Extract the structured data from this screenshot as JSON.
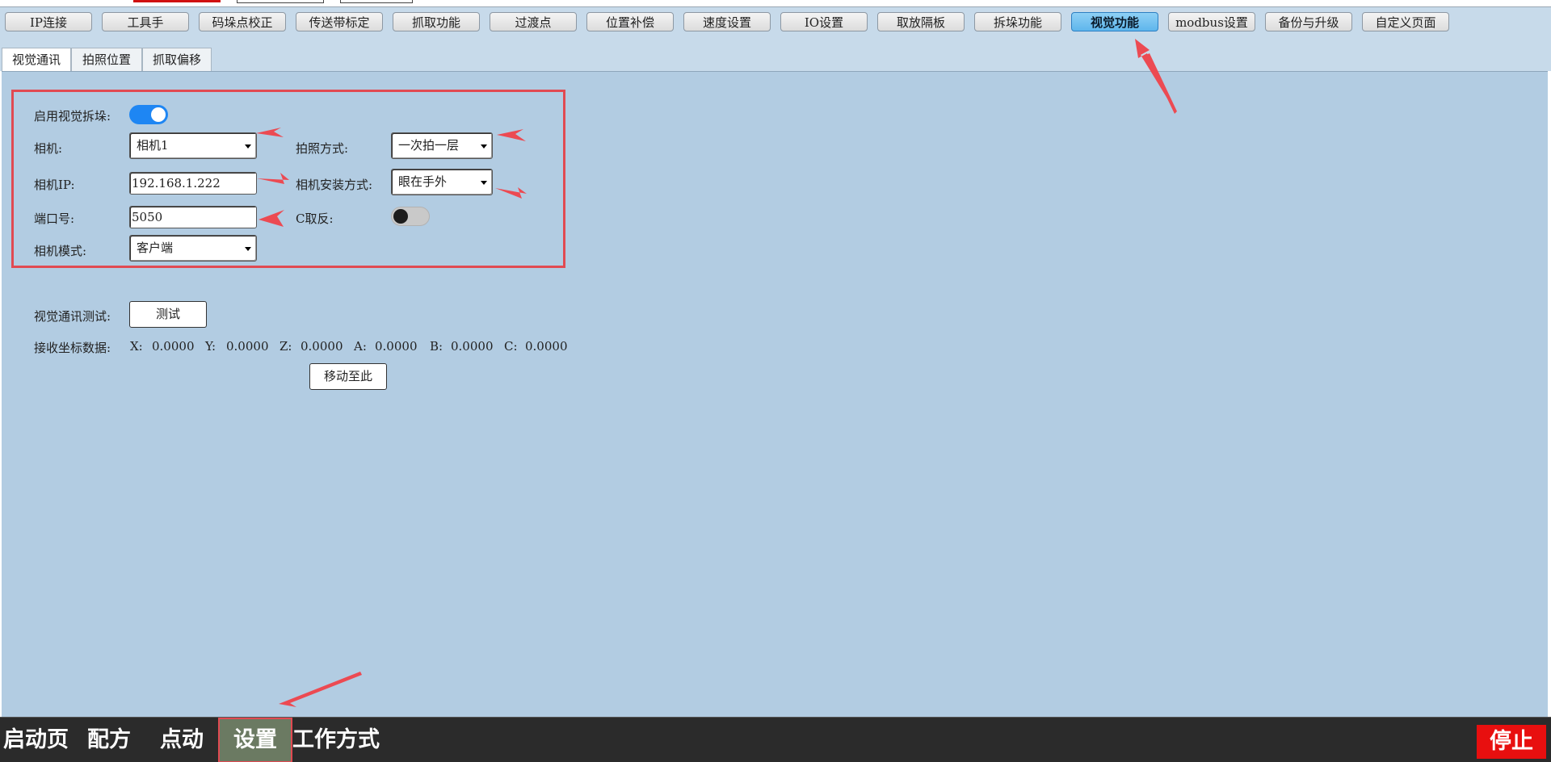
{
  "main_tabs": [
    {
      "label": "IP连接"
    },
    {
      "label": "工具手"
    },
    {
      "label": "码垛点校正"
    },
    {
      "label": "传送带标定"
    },
    {
      "label": "抓取功能"
    },
    {
      "label": "过渡点"
    },
    {
      "label": "位置补偿"
    },
    {
      "label": "速度设置"
    },
    {
      "label": "IO设置"
    },
    {
      "label": "取放隔板"
    },
    {
      "label": "拆垛功能"
    },
    {
      "label": "视觉功能",
      "active": true
    },
    {
      "label": "modbus设置"
    },
    {
      "label": "备份与升级"
    },
    {
      "label": "自定义页面"
    }
  ],
  "sub_tabs": [
    {
      "label": "视觉通讯",
      "active": true
    },
    {
      "label": "拍照位置"
    },
    {
      "label": "抓取偏移"
    }
  ],
  "settings": {
    "enable_label": "启用视觉拆垛:",
    "enable_on": true,
    "camera_label": "相机:",
    "camera_value": "相机1",
    "photo_mode_label": "拍照方式:",
    "photo_mode_value": "一次拍一层",
    "camera_ip_label": "相机IP:",
    "camera_ip_value": "192.168.1.222",
    "mount_label": "相机安装方式:",
    "mount_value": "眼在手外",
    "port_label": "端口号:",
    "port_value": "5050",
    "c_invert_label": "C取反:",
    "c_invert_on": false,
    "camera_mode_label": "相机模式:",
    "camera_mode_value": "客户端"
  },
  "test": {
    "label": "视觉通讯测试:",
    "button": "测试"
  },
  "coords": {
    "label": "接收坐标数据:",
    "x_label": "X:",
    "x_value": "0.0000",
    "y_label": "Y:",
    "y_value": "0.0000",
    "z_label": "Z:",
    "z_value": "0.0000",
    "a_label": "A:",
    "a_value": "0.0000",
    "b_label": "B:",
    "b_value": "0.0000",
    "c_label": "C:",
    "c_value": "0.0000",
    "move_button": "移动至此"
  },
  "bottom_nav": {
    "home": "启动页",
    "recipe": "配方",
    "jog": "点动",
    "settings": "设置",
    "work_mode": "工作方式",
    "stop": "停止"
  },
  "colors": {
    "accent_active_tab": "#5fb6ec",
    "annotation_red": "#e14a52",
    "stop_red": "#e80f0f",
    "toggle_on": "#1e86f3",
    "content_bg": "#b2cce2"
  }
}
